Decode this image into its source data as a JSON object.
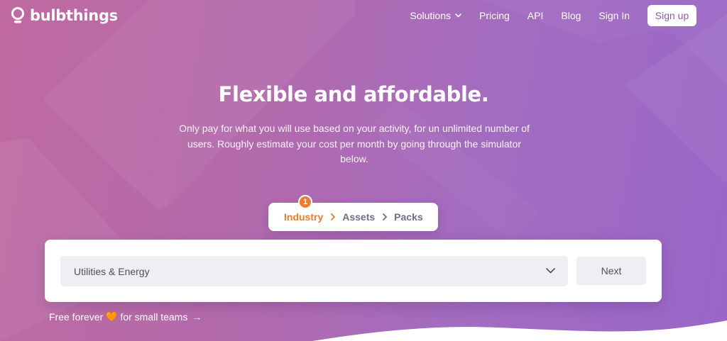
{
  "brand": {
    "name": "bulbthings"
  },
  "nav": {
    "links": [
      {
        "label": "Solutions",
        "has_dropdown": true
      },
      {
        "label": "Pricing"
      },
      {
        "label": "API"
      },
      {
        "label": "Blog"
      },
      {
        "label": "Sign In"
      }
    ],
    "signup_label": "Sign up"
  },
  "hero": {
    "title": "Flexible and affordable.",
    "subtitle": "Only pay for what you will use based on your activity, for un unlimited number of users. Roughly estimate your cost per month by going through the simulator below."
  },
  "stepper": {
    "current_step_number": "1",
    "steps": [
      {
        "label": "Industry",
        "active": true
      },
      {
        "label": "Assets",
        "active": false
      },
      {
        "label": "Packs",
        "active": false
      }
    ]
  },
  "simulator": {
    "industry_select_value": "Utilities & Energy",
    "next_label": "Next"
  },
  "free_link": {
    "text_before": "Free forever",
    "heart": "🧡",
    "text_after": "for small teams",
    "arrow": "→"
  },
  "colors": {
    "accent_orange": "#ef7b2c",
    "gradient_start": "#c06aa0",
    "gradient_end": "#9867c8",
    "signup_text": "#8a5db5"
  },
  "icons": [
    "bulb-logo-icon",
    "chevron-down-icon",
    "chevron-right-icon",
    "heart-icon",
    "arrow-right-icon"
  ]
}
